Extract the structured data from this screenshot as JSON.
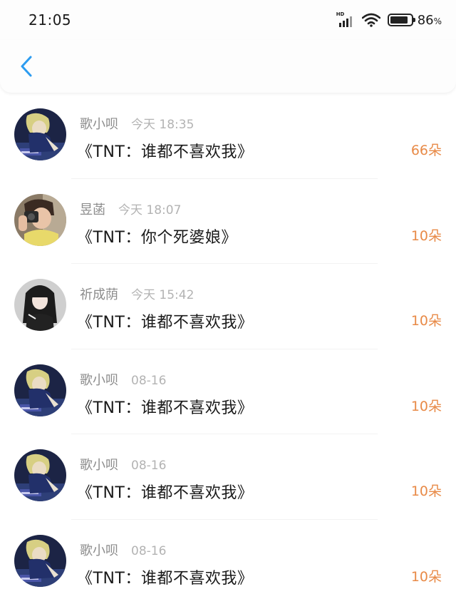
{
  "status_bar": {
    "time": "21:05",
    "signal_label": "HD",
    "battery_percent": "86",
    "battery_unit": "%"
  },
  "header": {
    "back_icon": "chevron-left-icon",
    "accent_color": "#2d9cf0"
  },
  "items": [
    {
      "name": "歌小呗",
      "time": "今天 18:35",
      "message": "《TNT：谁都不喜欢我》",
      "count": "66朵",
      "avatar": "anime-blue"
    },
    {
      "name": "昱菡",
      "time": "今天 18:07",
      "message": "《TNT：你个死婆娘》",
      "count": "10朵",
      "avatar": "photo-camera"
    },
    {
      "name": "祈成荫",
      "time": "今天 15:42",
      "message": "《TNT：谁都不喜欢我》",
      "count": "10朵",
      "avatar": "anime-girl"
    },
    {
      "name": "歌小呗",
      "time": "08-16",
      "message": "《TNT：谁都不喜欢我》",
      "count": "10朵",
      "avatar": "anime-blue"
    },
    {
      "name": "歌小呗",
      "time": "08-16",
      "message": "《TNT：谁都不喜欢我》",
      "count": "10朵",
      "avatar": "anime-blue"
    },
    {
      "name": "歌小呗",
      "time": "08-16",
      "message": "《TNT：谁都不喜欢我》",
      "count": "10朵",
      "avatar": "anime-blue"
    }
  ],
  "colors": {
    "count": "#e88a47",
    "name": "#8c8c8c",
    "time": "#b3b3b3",
    "message": "#1a1a1a"
  }
}
